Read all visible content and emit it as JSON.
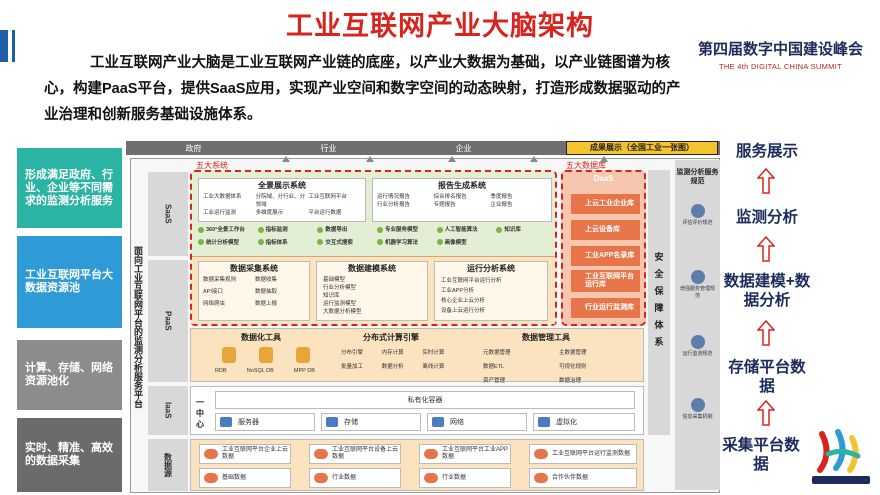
{
  "title": "工业互联网产业大脑架构",
  "intro": "工业互联网产业大脑是工业互联网产业链的底座，以产业大数据为基础，以产业链图谱为核心，构建PaaS平台，提供SaaS应用，实现产业空间和数字空间的动态映射，打造形成数据驱动的产业治理和创新服务基础设施体系。",
  "summit": {
    "cn": "第四届数字中国建设峰会",
    "en": "THE 4th DIGITAL CHINA SUMMIT"
  },
  "left_boxes": [
    {
      "text": "形成满足政府、行业、企业等不同需求的监测分析服务",
      "color": "#2bb3a3"
    },
    {
      "text": "工业互联网平台大数据资源池",
      "color": "#2f9bd6"
    },
    {
      "text": "计算、存储、网络资源池化",
      "color": "#8c8c8c"
    },
    {
      "text": "实时、精准、高效的数据采集",
      "color": "#6b6b6b"
    }
  ],
  "top_bar": [
    "政府",
    "行业",
    "企业"
  ],
  "showcase": "成果展示（全国工业一张图）",
  "vertical_label": "面向工业互联网平台的监测分析服务平台",
  "layers": {
    "saas": "SaaS",
    "paas": "PaaS",
    "iaas": "IaaS",
    "source": "数据源"
  },
  "saas_label": "五大系统",
  "daas_label": "五大数据库",
  "systems": {
    "full_display": "全景展示系统",
    "report": "报告生成系统",
    "collect": "数据采集系统",
    "model": "数据建模系统",
    "run": "运行分析系统"
  },
  "full_display_items": [
    "工业大数据体系",
    "分院域、分行业、分领域",
    "工业互联网平台",
    "工业运行监测",
    "多维度展示",
    "平台运行数据"
  ],
  "report_items": [
    "运行情况报告",
    "综合排名报告",
    "季度报告",
    "行业分析报告",
    "专题报告",
    "企业报告"
  ],
  "saas_row2": [
    "360°全景工作台",
    "指标监测",
    "数据导出",
    "专业服务模型",
    "人工智能算法",
    "知识库",
    "统计分析模型",
    "指标体系",
    "交互式搜索",
    "机器学习算法",
    "画像模型"
  ],
  "collect_items": [
    "数据采集规则",
    "数据收集",
    "API接口",
    "数据抽取",
    "网络爬虫",
    "数据上报"
  ],
  "model_items": [
    "基础模型",
    "行业分析模型",
    "知识库",
    "运行监测模型",
    "大数据分析模型",
    "行业分析模型"
  ],
  "run_items": [
    "工业互联网平台运行分析",
    "工业APP分析",
    "核心企业上云分析",
    "设备上云运行分析"
  ],
  "daas": {
    "title": "DaaS",
    "items": [
      "上云工业企业库",
      "上云设备库",
      "工业APP名录库",
      "工业互联网平台运行库",
      "行业运行监测库"
    ]
  },
  "paas_tools": {
    "data_tools": "数据化工具",
    "compute": "分布式计算引擎",
    "manage": "数据管理工具",
    "db": [
      "RDB",
      "NoSQL DB",
      "MPP DB"
    ],
    "compute_items": [
      "分布引擎",
      "内存计算",
      "实时计算",
      "批量加工",
      "数据分析",
      "离线计算",
      "数据服务",
      "日志分析"
    ],
    "manage_items": [
      "元数据管理",
      "主数据管理",
      "数据质量",
      "定制化",
      "数据ETL",
      "可视化规则",
      "资产管理",
      "数据治理"
    ]
  },
  "iaas": {
    "label": "一中心",
    "virtual": "私有化容器",
    "items": [
      "服务器",
      "存储",
      "网络",
      "虚拟化"
    ]
  },
  "sources": [
    "工业互联网平台企业上云数据",
    "工业互联网平台设备上云数据",
    "工业互联网平台工业APP数据",
    "工业互联网平台运行监测数据",
    "基础数据",
    "行业数据",
    "行业数据",
    "合作伙伴数据"
  ],
  "security": "安全保障体系",
  "monitor": {
    "caption": "监测分析服务规范",
    "items": [
      "评估评价规范",
      "增强服务管理规范",
      "运行监测规范",
      "信息采集机制"
    ]
  },
  "right_flow": [
    "服务展示",
    "监测分析",
    "数据建模+数据分析",
    "存储平台数据",
    "采集平台数据"
  ]
}
